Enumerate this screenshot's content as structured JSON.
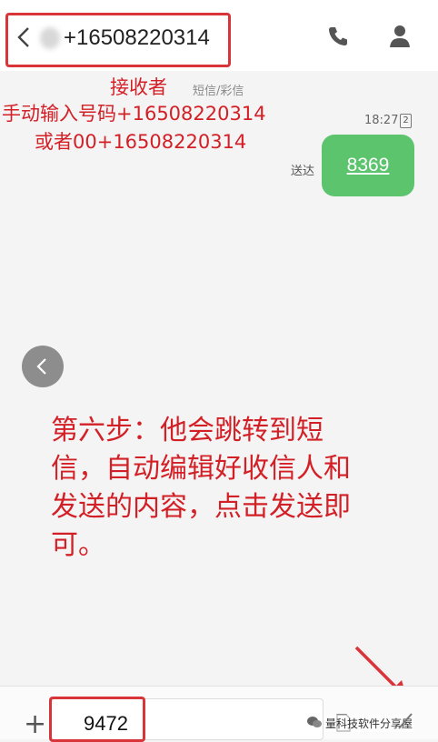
{
  "header": {
    "phone_number": "+16508220314"
  },
  "annotations": {
    "receiver": "接收者",
    "manual_input": "手动输入号码+16508220314",
    "or_format": "或者00+16508220314",
    "step_line1": "第六步：他会跳转到短",
    "step_line2": "信，自动编辑好收信人和",
    "step_line3": "发送的内容，点击发送即",
    "step_line4": "可。"
  },
  "conversation": {
    "channel_label": "短信/彩信",
    "time": "18:27",
    "sim_slot": "2",
    "status": "送达",
    "message_text": "8369"
  },
  "composer": {
    "input_value": "9472"
  },
  "watermark": "量科技软件分享屋",
  "colors": {
    "annotation_red": "#d31f26",
    "bubble_green": "#5cc46d"
  },
  "icons": {
    "back": "chevron-left",
    "call": "phone",
    "contact": "person",
    "add": "plus",
    "send": "send-arrow"
  }
}
